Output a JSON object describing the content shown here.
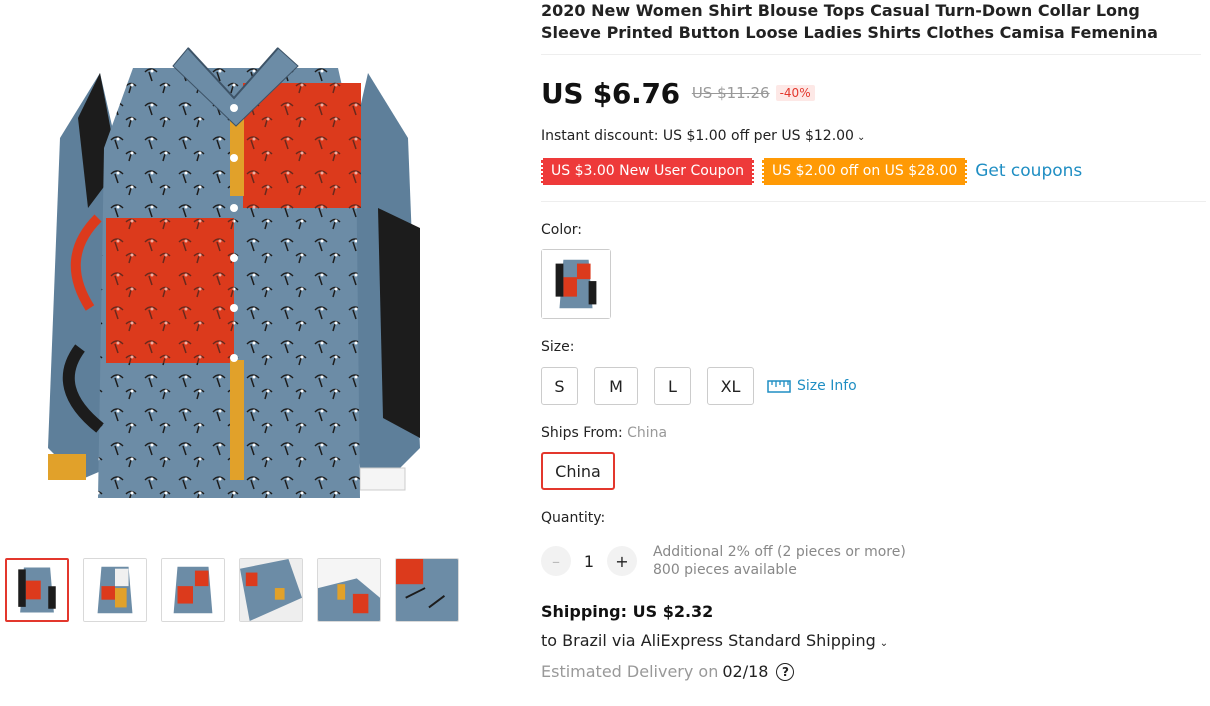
{
  "product": {
    "title": "2020 New Women Shirt Blouse Tops Casual Turn-Down Collar Long Sleeve Printed Button Loose Ladies Shirts Clothes Camisa Femenina"
  },
  "price": {
    "current": "US $6.76",
    "original": "US $11.26",
    "discount": "-40%"
  },
  "instant_discount": "Instant discount: US $1.00 off per US $12.00",
  "coupons": {
    "new_user": "US $3.00 New User Coupon",
    "off": "US $2.00 off on US $28.00",
    "get_label": "Get coupons"
  },
  "color": {
    "label": "Color:"
  },
  "size": {
    "label": "Size:",
    "options": [
      "S",
      "M",
      "L",
      "XL"
    ],
    "info_label": "Size Info"
  },
  "ships_from": {
    "label": "Ships From:",
    "selected": "China",
    "option": "China"
  },
  "quantity": {
    "label": "Quantity:",
    "value": "1",
    "minus": "–",
    "plus": "+",
    "note1": "Additional 2% off (2 pieces or more)",
    "note2": "800 pieces available"
  },
  "shipping": {
    "title": "Shipping: US $2.32",
    "to": "to Brazil via AliExpress Standard Shipping",
    "estimated_label": "Estimated Delivery on",
    "date": "02/18",
    "help": "?"
  },
  "colors": {
    "accent_red": "#e3372d",
    "coupon_red": "#ee3a3a",
    "coupon_orange": "#ff9a05",
    "link_blue": "#1f8ec3"
  },
  "icons": [
    "chevron-down-icon",
    "ruler-icon",
    "help-icon"
  ]
}
